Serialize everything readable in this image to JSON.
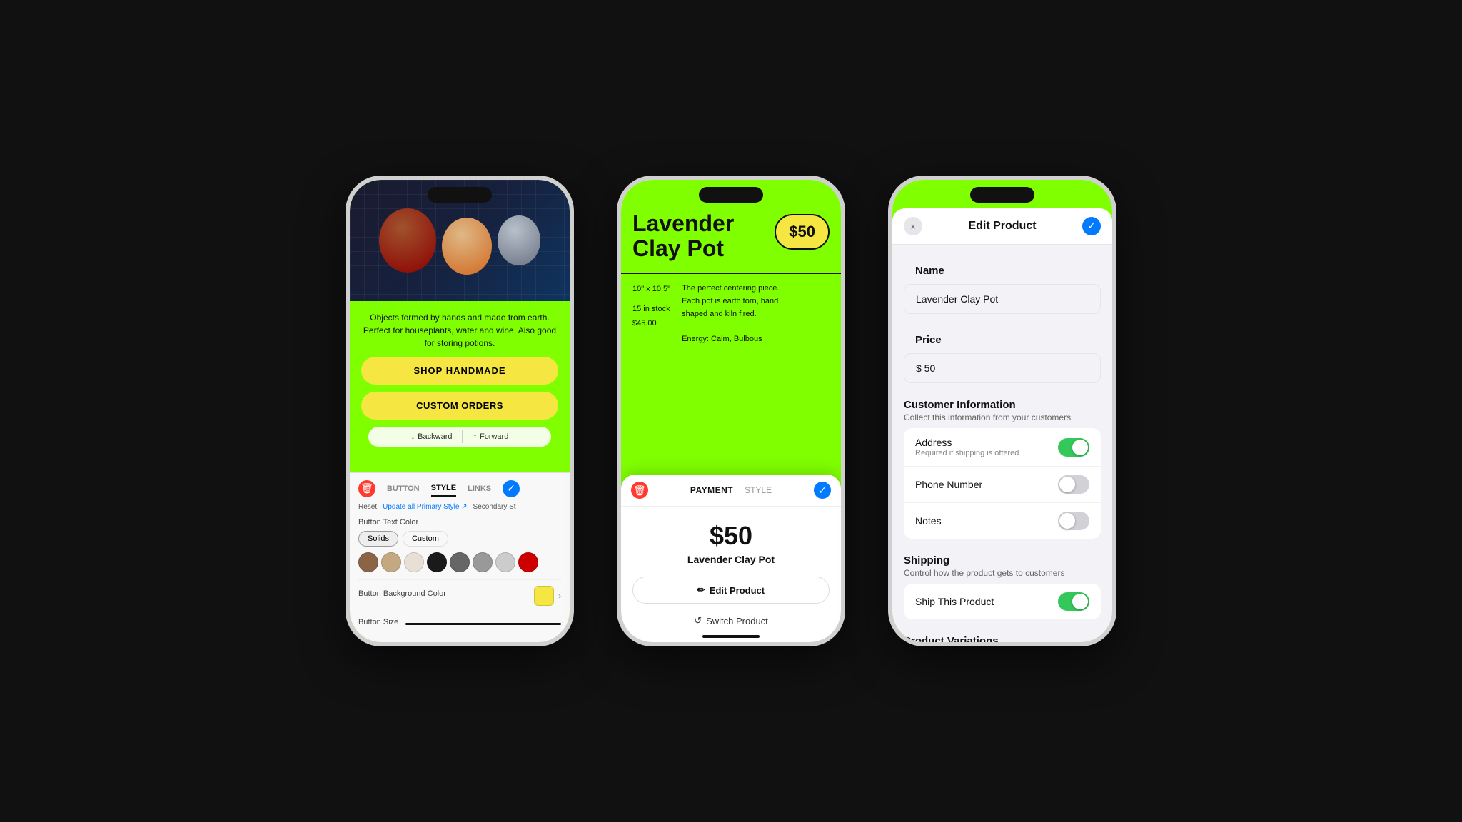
{
  "phone1": {
    "desc": "Objects formed by hands and made from earth. Perfect for houseplants, water and wine. Also good for storing potions.",
    "btn1": "SHOP HANDMADE",
    "btn2": "CUSTOM ORDERS",
    "backward": "Backward",
    "forward": "Forward",
    "tabs": {
      "button": "BUTTON",
      "style": "STYLE",
      "links": "LINKS"
    },
    "actions": {
      "reset": "Reset",
      "update": "Update all Primary Style ↗",
      "secondary": "Secondary St"
    },
    "textColorLabel": "Button Text Color",
    "colorOpts": [
      "Solids",
      "Custom"
    ],
    "bgColorLabel": "Button Background Color",
    "btnSizeLabel": "Button Size",
    "swatches": [
      "#8B6347",
      "#c4a882",
      "#d4b896",
      "#ffffff",
      "#1a1a1a",
      "#888888",
      "#aaaaaa",
      "#cccccc",
      "#cc0000"
    ]
  },
  "phone2": {
    "title": "Lavender\nClay Pot",
    "price": "$50",
    "dimensions": "10\" x 10.5\"",
    "stock": "15 in stock",
    "originalPrice": "$45.00",
    "descLine1": "The perfect centering piece.",
    "descLine2": "Each pot is earth torn, hand",
    "descLine3": "shaped and kiln fired.",
    "descLine4": "",
    "energy": "Energy: Calm, Bulbous",
    "payment": {
      "tabActive": "PAYMENT",
      "tabInactive": "STYLE",
      "amount": "$50",
      "productName": "Lavender Clay Pot",
      "editBtn": "Edit Product",
      "switchBtn": "Switch Product"
    }
  },
  "phone3": {
    "modalTitle": "Edit Product",
    "closeBtnLabel": "×",
    "checkBtnLabel": "✓",
    "nameLabel": "Name",
    "namePlaceholder": "Lavender Clay Pot",
    "priceLabel": "Price",
    "priceValue": "$ 50",
    "customerInfoLabel": "Customer Information",
    "customerInfoSub": "Collect this information from your customers",
    "addressLabel": "Address",
    "addressSub": "Required if shipping is offered",
    "addressOn": true,
    "phoneLabel": "Phone Number",
    "phoneOn": false,
    "notesLabel": "Notes",
    "notesOn": false,
    "shippingLabel": "Shipping",
    "shippingSub": "Control how the product gets to customers",
    "shipLabel": "Ship This Product",
    "shipOn": true,
    "variationsLabel": "Product Variations"
  },
  "icons": {
    "backward": "↓",
    "forward": "↑",
    "trash": "🗑",
    "check": "✓",
    "close": "×",
    "pencil": "✏",
    "refresh": "↺",
    "chevron": "›"
  }
}
